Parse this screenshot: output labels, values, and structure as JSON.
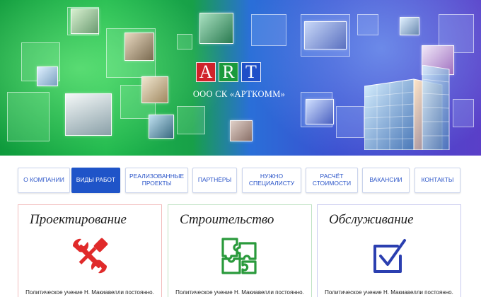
{
  "hero": {
    "logo_letters": [
      "A",
      "R",
      "T"
    ],
    "company_name": "ООО СК «АРТКОММ»",
    "colors": {
      "red": "#d0222a",
      "green": "#1a9a3c",
      "blue": "#1f4fc8"
    }
  },
  "nav": {
    "items": [
      {
        "label": "О КОМПАНИИ",
        "active": false
      },
      {
        "label": "ВИДЫ РАБОТ",
        "active": true
      },
      {
        "label": "РЕАЛИЗОВАННЫЕ ПРОЕКТЫ",
        "active": false
      },
      {
        "label": "ПАРТНЁРЫ",
        "active": false
      },
      {
        "label": "НУЖНО СПЕЦИАЛИСТУ",
        "active": false
      },
      {
        "label": "РАСЧЁТ СТОИМОСТИ",
        "active": false
      },
      {
        "label": "ВАКАНСИИ",
        "active": false
      },
      {
        "label": "КОНТАКТЫ",
        "active": false
      }
    ],
    "active_color": "#1f54c8"
  },
  "services": [
    {
      "title": "Проектирование",
      "icon": "wrench-screwdriver-icon",
      "color": "#e02a2a",
      "text": "Политическое учение Н. Макиавелли постоянно."
    },
    {
      "title": "Строительство",
      "icon": "puzzle-icon",
      "color": "#2a9a3c",
      "text": "Политическое учение Н. Макиавелли постоянно."
    },
    {
      "title": "Обслуживание",
      "icon": "checkbox-icon",
      "color": "#2b3fb0",
      "text": "Политическое учение Н. Макиавелли постоянно."
    }
  ]
}
